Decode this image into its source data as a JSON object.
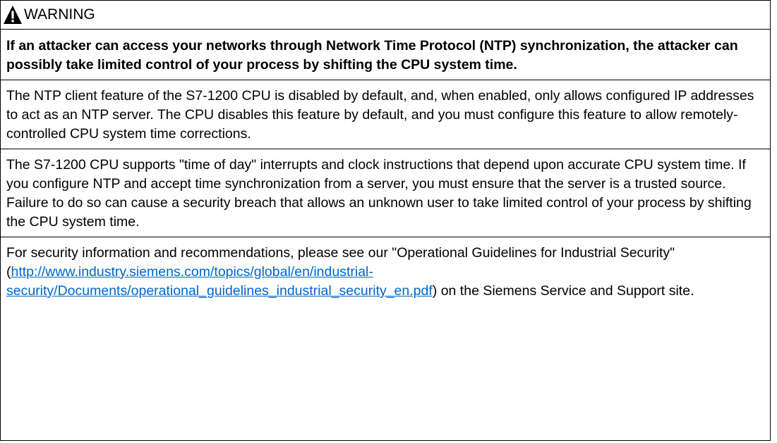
{
  "warning": {
    "icon": "warning-triangle-icon",
    "title": "WARNING",
    "accent_color": "#000000"
  },
  "paragraphs": {
    "lead": "If an attacker can access your networks through Network Time Protocol (NTP) synchronization, the attacker can possibly take limited control of your process by shifting the CPU system time.",
    "ntp_client": "The NTP client feature of the S7-1200 CPU is disabled by default, and, when enabled, only allows configured IP addresses to act as an NTP server. The CPU disables this feature by default, and you must configure this feature to allow remotely-controlled CPU system time corrections.",
    "time_of_day": "The S7-1200 CPU supports \"time of day\" interrupts and clock instructions that depend upon accurate CPU system time. If you configure NTP and accept time synchronization from a server, you must ensure that the server is a trusted source. Failure to do so can cause a security breach that allows an unknown user to take limited control of your process by shifting the CPU system time.",
    "security_info_before": "For security information and recommendations, please see our \"Operational Guidelines for Industrial Security\" (",
    "security_info_link": "http://www.industry.siemens.com/topics/global/en/industrial-security/Documents/operational_guidelines_industrial_security_en.pdf",
    "security_info_after": ") on the Siemens Service and Support site."
  },
  "colors": {
    "link": "#0066cc",
    "border": "#000000"
  }
}
